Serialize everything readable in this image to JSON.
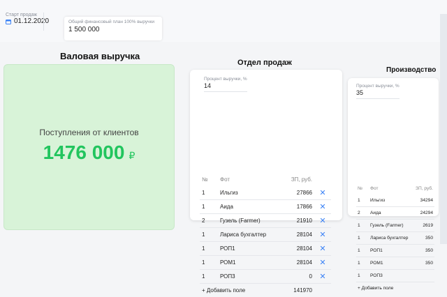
{
  "top": {
    "start_label": "Старт продаж",
    "start_date": "01.12.2020",
    "plan_label": "Общий финансовый план 100% выручки",
    "plan_value": "1 500 000"
  },
  "revenue": {
    "title": "Валовая выручка",
    "subtitle": "Поступления от клиентов",
    "amount": "1476 000",
    "currency": "₽"
  },
  "sales": {
    "title": "Отдел продаж",
    "percent_label": "Процент выручки, %",
    "percent_value": "14",
    "headers": [
      "№",
      "Фот",
      "ЗП, руб."
    ],
    "rows": [
      {
        "n": "1",
        "name": "Ильгиз",
        "salary": "27866"
      },
      {
        "n": "1",
        "name": "Аида",
        "salary": "17866"
      },
      {
        "n": "2",
        "name": "Гузель (Farmer)",
        "salary": "21910"
      },
      {
        "n": "1",
        "name": "Лариса бухгалтер",
        "salary": "28104"
      },
      {
        "n": "1",
        "name": "РОП1",
        "salary": "28104"
      },
      {
        "n": "1",
        "name": "РОМ1",
        "salary": "28104"
      },
      {
        "n": "1",
        "name": "РОП3",
        "salary": "0"
      }
    ],
    "add_label": "+ Добавить поле",
    "total": "141970"
  },
  "production": {
    "title": "Производство",
    "percent_label": "Процент выручки, %",
    "percent_value": "35",
    "headers": [
      "№",
      "Фот",
      "ЗП, руб."
    ],
    "rows": [
      {
        "n": "1",
        "name": "Ильгиз",
        "salary": "34294"
      },
      {
        "n": "2",
        "name": "Аида",
        "salary": "24294"
      },
      {
        "n": "1",
        "name": "Гузель (Farmer)",
        "salary": "2619"
      },
      {
        "n": "1",
        "name": "Лариса бухгалтер",
        "salary": "350"
      },
      {
        "n": "1",
        "name": "РОП1",
        "salary": "350"
      },
      {
        "n": "1",
        "name": "РОМ1",
        "salary": "350"
      },
      {
        "n": "1",
        "name": "РОП3",
        "salary": ""
      }
    ],
    "add_label": "+ Добавить поле"
  },
  "colors": {
    "accent": "#3b82f6",
    "revenue_green": "#22c55e",
    "revenue_bg": "#d8f3d8"
  }
}
